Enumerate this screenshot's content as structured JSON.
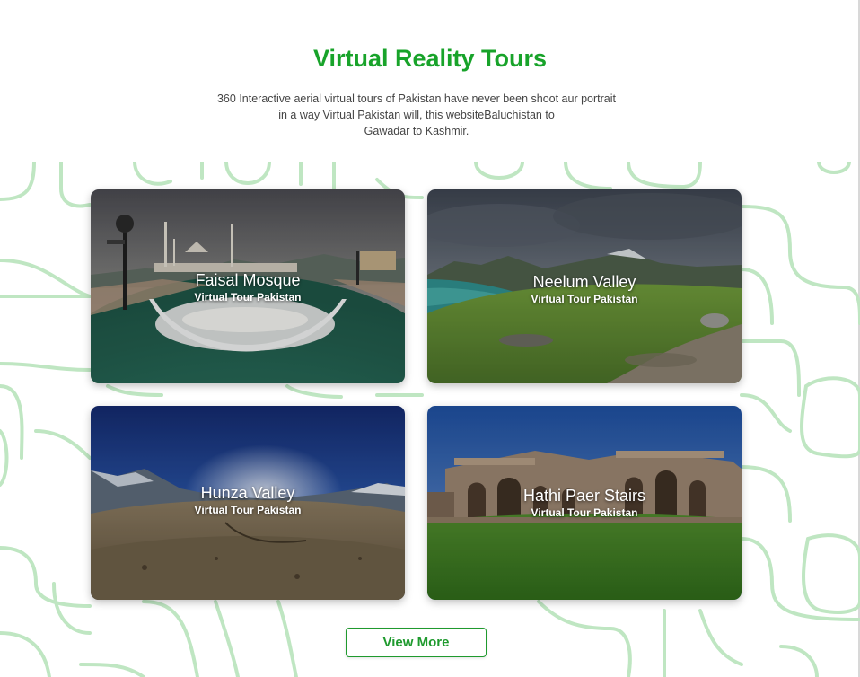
{
  "section": {
    "title": "Virtual Reality Tours",
    "description_lines": [
      "360 Interactive aerial virtual tours of Pakistan have never been shoot aur portrait",
      "in a way Virtual Pakistan will, this websiteBaluchistan to",
      "Gawadar to Kashmir."
    ]
  },
  "tours": [
    {
      "name": "Faisal Mosque",
      "subtitle": "Virtual Tour Pakistan"
    },
    {
      "name": "Neelum Valley",
      "subtitle": "Virtual Tour Pakistan"
    },
    {
      "name": "Hunza Valley",
      "subtitle": "Virtual Tour Pakistan"
    },
    {
      "name": "Hathi Paer Stairs",
      "subtitle": "Virtual Tour Pakistan"
    }
  ],
  "actions": {
    "view_more_label": "View More"
  },
  "colors": {
    "accent_green": "#18a32a",
    "pattern_green": "#bfe6c2",
    "button_border": "#1f9a2e"
  }
}
